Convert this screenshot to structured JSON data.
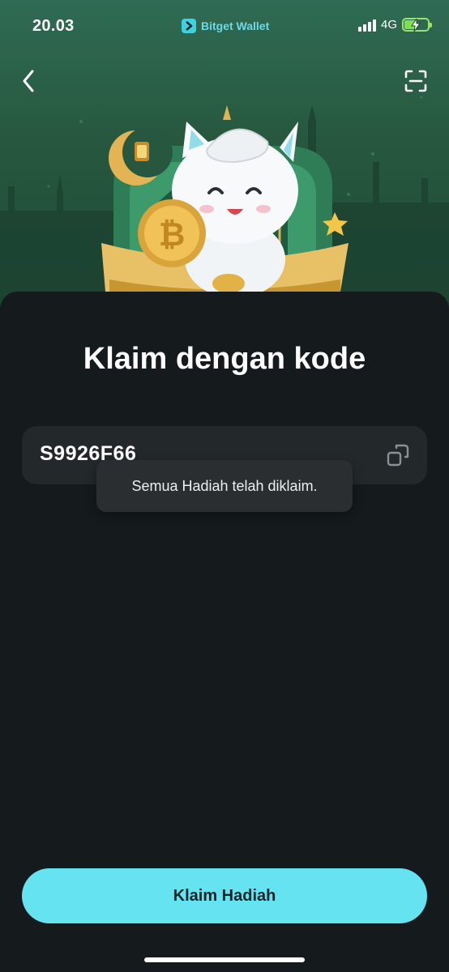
{
  "status_bar": {
    "time": "20.03",
    "app_name": "Bitget Wallet",
    "network": "4G"
  },
  "header": {
    "back_icon": "chevron-left-icon",
    "scan_icon": "scan-icon"
  },
  "hero": {
    "illustration": "mascot-cat-with-bitcoin-mosque-scene"
  },
  "main": {
    "title": "Klaim dengan kode",
    "code_value": "S9926F66",
    "paste_icon": "paste-icon",
    "toast_message": "Semua Hadiah telah diklaim.",
    "claim_button_label": "Klaim Hadiah"
  },
  "colors": {
    "accent": "#66e3f0",
    "background": "#151a1c",
    "hero_green": "#27583f",
    "battery": "#7ee04f"
  }
}
